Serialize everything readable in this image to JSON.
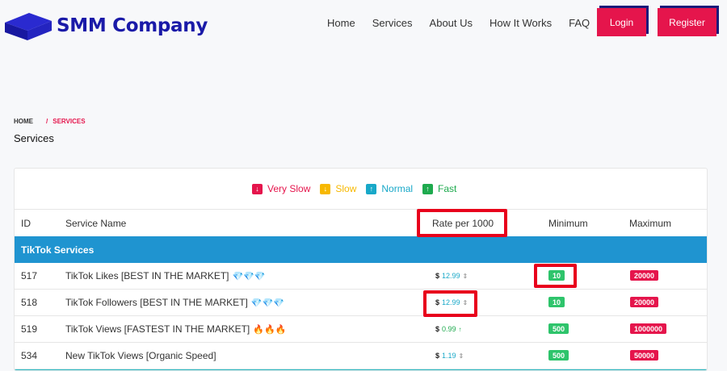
{
  "brand": {
    "name": "SMM Company"
  },
  "nav": {
    "items": [
      "Home",
      "Services",
      "About Us",
      "How It Works",
      "FAQ"
    ],
    "login": "Login",
    "register": "Register"
  },
  "breadcrumb": {
    "home": "HOME",
    "separator": "/",
    "current": "SERVICES"
  },
  "page_title": "Services",
  "legend": {
    "very_slow": "Very Slow",
    "slow": "Slow",
    "normal": "Normal",
    "fast": "Fast"
  },
  "table": {
    "headers": {
      "id": "ID",
      "name": "Service Name",
      "rate": "Rate per 1000",
      "min": "Minimum",
      "max": "Maximum"
    },
    "category": "TikTok Services",
    "currency": "$",
    "rows": [
      {
        "id": "517",
        "name": "TikTok Likes [BEST IN THE MARKET]",
        "emoji": "💎💎💎",
        "rate": "12.99",
        "min": "10",
        "max": "20000"
      },
      {
        "id": "518",
        "name": "TikTok Followers [BEST IN THE MARKET]",
        "emoji": "💎💎💎",
        "rate": "12.99",
        "min": "10",
        "max": "20000"
      },
      {
        "id": "519",
        "name": "TikTok Views [FASTEST IN THE MARKET]",
        "emoji": "🔥🔥🔥",
        "rate": "0.99",
        "min": "500",
        "max": "1000000"
      },
      {
        "id": "534",
        "name": "New TikTok Views [Organic Speed]",
        "emoji": "",
        "rate": "1.19",
        "min": "500",
        "max": "50000"
      }
    ]
  },
  "colors": {
    "accent": "#e5154c",
    "brand": "#1a1aa8",
    "category_bar": "#1f94d0",
    "min_badge": "#2ec46b",
    "highlight": "#e8001c"
  }
}
